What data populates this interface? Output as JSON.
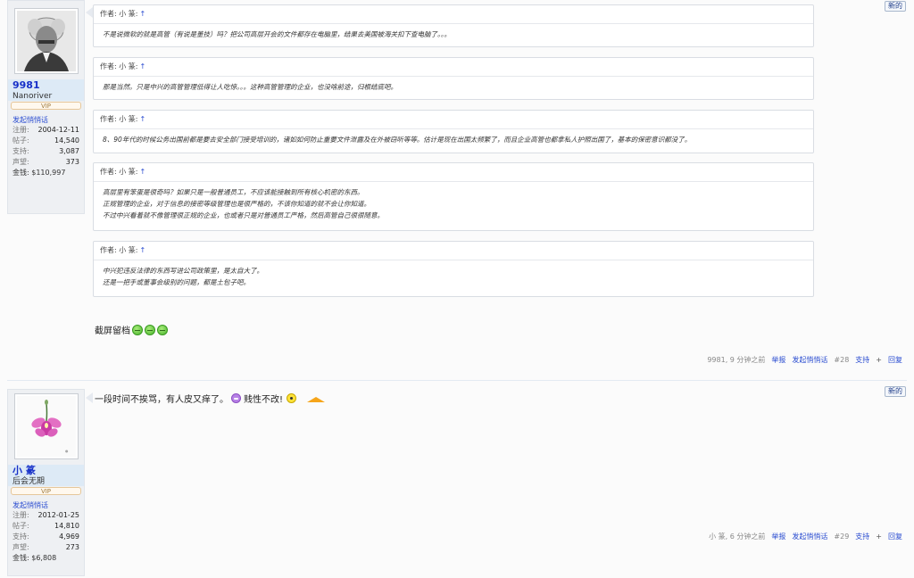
{
  "new_badge": "新的",
  "posts": [
    {
      "user": {
        "name": "9981",
        "subtitle": "Nanoriver",
        "vip": "VIP",
        "pm": "发起悄悄话",
        "stats": [
          {
            "k": "注册:",
            "v": "2004-12-11"
          },
          {
            "k": "帖子:",
            "v": "14,540"
          },
          {
            "k": "支持:",
            "v": "3,087"
          },
          {
            "k": "声望:",
            "v": "373"
          }
        ],
        "money_label": "金钱: $110,997"
      },
      "quotes": [
        {
          "head": "作者: 小 篆:",
          "lines": [
            "不是说微软的就是高管（有说是董技）吗？把公司高层开会的文件都存在电脑里，结果去美国被海关扣下查电脑了。。。"
          ]
        },
        {
          "head": "作者: 小 篆:",
          "lines": [
            "那是当然。只是中兴的高管管理低得让人吃惊。。。这种高管管理的企业，也没啥前途，归根结底吧。"
          ]
        },
        {
          "head": "作者: 小 篆:",
          "lines": [
            "8、90年代的时候公务出国前都是要去安全部门接受培训的，诸如如何防止重要文件泄露及在外被窃听等等。估计是现在出国太频繁了，而且企业高管也都拿私人护照出国了，基本的保密意识都没了。"
          ]
        },
        {
          "head": "作者: 小 篆:",
          "lines": [
            "高层里有笨蛋是很奇吗？如果只是一般普通员工，不应该能接触到所有核心机密的东西。",
            "正规管理的企业，对于信息的接密等级管理也是很严格的，不该你知道的就不会让你知道。",
            "不过中兴看着就不像管理很正规的企业，也或者只是对普通员工严格，然后高管自己很很随意。"
          ]
        },
        {
          "head": "作者: 小 篆:",
          "lines": [
            "中兴犯违反法律的东西写进公司政策里，是太自大了。",
            "还是一把手或董事会级别的问题，都是土包子吧。"
          ]
        }
      ],
      "note": "截屏留档",
      "footer": {
        "meta": "9981, 9 分钟之前",
        "report": "举报",
        "pm": "发起悄悄话",
        "num": "#28",
        "support": "支持",
        "plus": "+",
        "reply": "回复"
      }
    },
    {
      "user": {
        "name": "小 篆",
        "subtitle": "后会无期",
        "vip": "VIP",
        "pm": "发起悄悄话",
        "stats": [
          {
            "k": "注册:",
            "v": "2012-01-25"
          },
          {
            "k": "帖子:",
            "v": "14,810"
          },
          {
            "k": "支持:",
            "v": "4,969"
          },
          {
            "k": "声望:",
            "v": "273"
          }
        ],
        "money_label": "金钱: $6,808"
      },
      "text_a": "一段时间不挨骂，有人皮又痒了。",
      "text_b": "贱性不改!",
      "footer": {
        "meta": "小 篆, 6 分钟之前",
        "report": "举报",
        "pm": "发起悄悄话",
        "num": "#29",
        "support": "支持",
        "plus": "+",
        "reply": "回复"
      }
    }
  ]
}
